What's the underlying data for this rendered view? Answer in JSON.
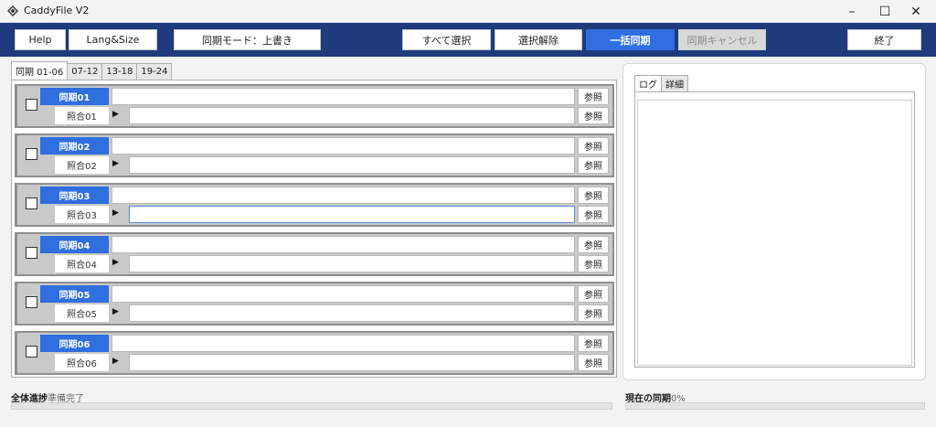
{
  "window": {
    "title": "CaddyFile V2",
    "minimize": "–",
    "maximize": "☐",
    "close": "✕",
    "app_icon": "caddy-app-icon"
  },
  "toolbar": {
    "help": "Help",
    "lang_size": "Lang&Size",
    "sync_mode": "同期モード：上書き",
    "select_all": "すべて選択",
    "deselect": "選択解除",
    "bulk_sync": "一括同期",
    "cancel_sync": "同期キャンセル",
    "exit": "終了"
  },
  "tabs": [
    {
      "label": "同期 01-06",
      "active": true
    },
    {
      "label": "07-12",
      "active": false
    },
    {
      "label": "13-18",
      "active": false
    },
    {
      "label": "19-24",
      "active": false
    }
  ],
  "rows": [
    {
      "sync_label": "同期01",
      "ref_label": "照合01",
      "sync_value": "",
      "ref_value": "",
      "browse": "参照",
      "checked": false
    },
    {
      "sync_label": "同期02",
      "ref_label": "照合02",
      "sync_value": "",
      "ref_value": "",
      "browse": "参照",
      "checked": false
    },
    {
      "sync_label": "同期03",
      "ref_label": "照合03",
      "sync_value": "",
      "ref_value": "",
      "browse": "参照",
      "checked": false
    },
    {
      "sync_label": "同期04",
      "ref_label": "照合04",
      "sync_value": "",
      "ref_value": "",
      "browse": "参照",
      "checked": false
    },
    {
      "sync_label": "同期05",
      "ref_label": "照合05",
      "sync_value": "",
      "ref_value": "",
      "browse": "参照",
      "checked": false
    },
    {
      "sync_label": "同期06",
      "ref_label": "照合06",
      "sync_value": "",
      "ref_value": "",
      "browse": "参照",
      "checked": false
    }
  ],
  "log": {
    "tab_log": "ログ",
    "tab_detail": "詳細"
  },
  "status": {
    "overall_label": "全体進捗",
    "overall_value": "準備完了",
    "overall_progress": 0,
    "current_label": "現在の同期",
    "current_value": "0%",
    "current_progress": 0
  },
  "colors": {
    "accent": "#2f6fe0",
    "toolbar_bg": "#1e3b7d"
  }
}
